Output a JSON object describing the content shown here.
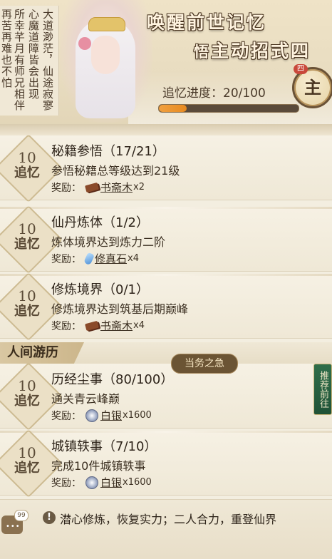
{
  "header": {
    "poem_columns": [
      "大道渺茫，仙途寂寥",
      "心魔道障皆会出现",
      "所幸芊月有师兄相伴",
      "再苦再难也不怕"
    ],
    "title_line1": "唤醒前世记忆",
    "title_line2_small": "悟",
    "title_line2": "主动招式四",
    "progress_label": "追忆进度：20/100",
    "progress_value": 20,
    "progress_max": 100,
    "badge_char": "主",
    "badge_number": "四"
  },
  "tasks": [
    {
      "reward_num": "10",
      "reward_word": "追忆",
      "title": "秘籍参悟（17/21）",
      "desc": "参悟秘籍总等级达到21级",
      "reward_label": "奖励：",
      "item_icon": "wood-icon",
      "item_name": "书斋木",
      "qty": "x2"
    },
    {
      "reward_num": "10",
      "reward_word": "追忆",
      "title": "仙丹炼体（1/2）",
      "desc": "炼体境界达到炼力二阶",
      "reward_label": "奖励：",
      "item_icon": "stone-icon",
      "item_name": "修真石",
      "qty": "x4"
    },
    {
      "reward_num": "10",
      "reward_word": "追忆",
      "title": "修炼境界（0/1）",
      "desc": "修炼境界达到筑基后期巅峰",
      "reward_label": "奖励：",
      "item_icon": "wood-icon",
      "item_name": "书斋木",
      "qty": "x4"
    },
    {
      "reward_num": "10",
      "reward_word": "追忆",
      "title": "历经尘事（80/100）",
      "desc": "通关青云峰巅",
      "reward_label": "奖励：",
      "item_icon": "silver-icon",
      "item_name": "白银",
      "qty": "x1600"
    },
    {
      "reward_num": "10",
      "reward_word": "追忆",
      "title": "城镇轶事（7/10）",
      "desc": "完成10件城镇轶事",
      "reward_label": "奖励：",
      "item_icon": "silver-icon",
      "item_name": "白银",
      "qty": "x1600"
    }
  ],
  "section": {
    "label": "人间游历"
  },
  "urgent_tag": "当务之急",
  "recommend_button": "推荐前往",
  "bottom": {
    "chat_count": "99",
    "notice_icon": "!",
    "notice_text": "潜心修炼，恢复实力；二人合力，重登仙界"
  },
  "colors": {
    "accent": "#e78a20",
    "badge_red": "#c9483a",
    "recommend_green": "#2f6e4a"
  }
}
